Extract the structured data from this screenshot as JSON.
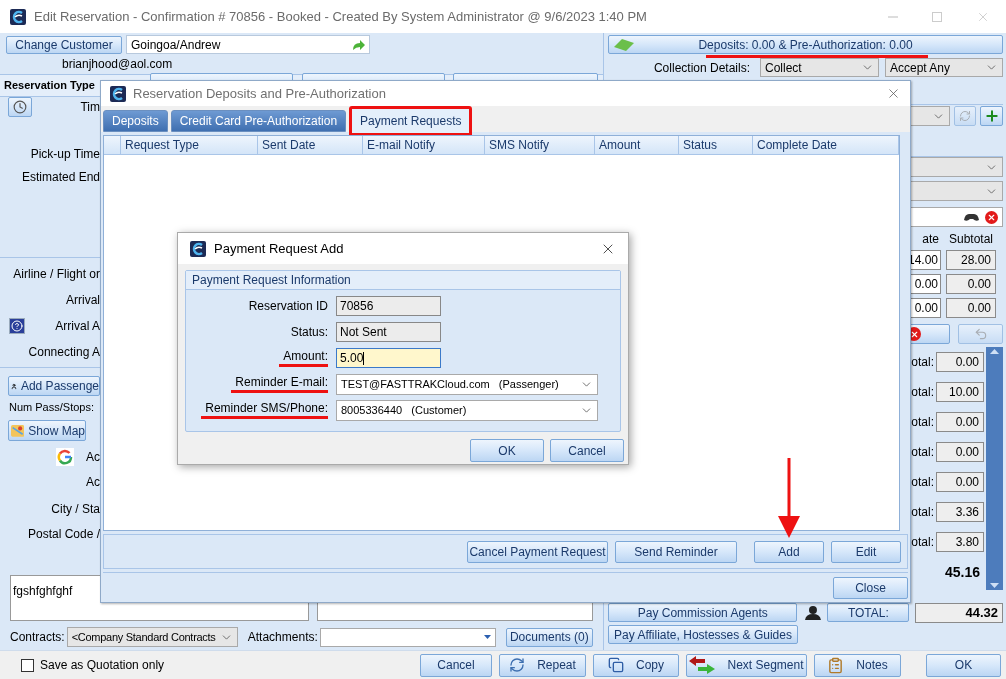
{
  "window": {
    "title": "Edit Reservation - Confirmation # 70856 - Booked - Created By System Administrator @ 9/6/2023 1:40 PM"
  },
  "customer": {
    "button": "Change Customer",
    "name": "Goingoa/Andrew",
    "email": "brianjhood@aol.com"
  },
  "reservation_type": {
    "label": "Reservation Type"
  },
  "trip_labels": [
    "Tim",
    "Pick-up Time",
    "Estimated End"
  ],
  "flight_labels": [
    "Airline / Flight or",
    "Arrival",
    "Arrival A",
    "Connecting A"
  ],
  "passengers": {
    "add_button": "Add Passenge",
    "count_label": "Num Pass/Stops:",
    "map_button": "Show Map"
  },
  "address_labels": [
    "Ac",
    "Ac",
    "City / Sta",
    "Postal Code /"
  ],
  "notes_text": "fgshfghfghf",
  "contracts": {
    "label": "Contracts:",
    "value": "<Company Standard Contracts"
  },
  "attachments": {
    "label": "Attachments:",
    "button": "Documents (0)"
  },
  "quotation": {
    "label": "Save as Quotation only",
    "checked": false
  },
  "footer_buttons": [
    {
      "label": "Cancel",
      "kind": "plain"
    },
    {
      "label": "Repeat",
      "kind": "repeat"
    },
    {
      "label": "Copy",
      "kind": "copy"
    },
    {
      "label": "Next Segment",
      "kind": "next"
    },
    {
      "label": "Notes",
      "kind": "notes"
    },
    {
      "label": "OK",
      "kind": "plain"
    }
  ],
  "deposits_button": {
    "label": "Deposits: 0.00 & Pre-Authorization: 0.00",
    "underlined": true
  },
  "collection": {
    "label": "Collection Details:",
    "method": "Collect",
    "accept": "Accept Any"
  },
  "rates": {
    "headers": [
      "ate",
      "Subtotal"
    ],
    "rows": [
      [
        "14.00",
        "28.00"
      ],
      [
        "0.00",
        "0.00"
      ],
      [
        "0.00",
        "0.00"
      ]
    ]
  },
  "totals": {
    "rows": [
      {
        "label": "otal:",
        "value": "0.00"
      },
      {
        "label": "otal:",
        "value": "10.00"
      },
      {
        "label": "otal:",
        "value": "0.00"
      },
      {
        "label": "otal:",
        "value": "0.00"
      },
      {
        "label": "otal:",
        "value": "0.00"
      },
      {
        "label": "otal:",
        "value": "3.36"
      },
      {
        "label": "otal:",
        "value": "3.80"
      }
    ],
    "sum": "45.16"
  },
  "commission": {
    "button": "Pay Commission Agents",
    "total_label": "TOTAL:",
    "total_value": "44.32",
    "affiliate_button": "Pay Affiliate, Hostesses & Guides"
  },
  "deposits_dialog": {
    "title": "Reservation Deposits and Pre-Authorization",
    "tabs": [
      {
        "label": "Deposits",
        "selected": false,
        "highlighted": false
      },
      {
        "label": "Credit Card Pre-Authorization",
        "selected": false,
        "highlighted": false
      },
      {
        "label": "Payment Requests",
        "selected": true,
        "highlighted": true
      }
    ],
    "columns": [
      "Request Type",
      "Sent Date",
      "E-mail Notify",
      "SMS Notify",
      "Amount",
      "Status",
      "Complete Date"
    ],
    "buttons": [
      {
        "label": "Cancel Payment Request",
        "arrow": false
      },
      {
        "label": "Send Reminder",
        "arrow": false
      },
      {
        "label": "Add",
        "arrow": true
      },
      {
        "label": "Edit",
        "arrow": false
      }
    ],
    "close_button": "Close"
  },
  "payment_dialog": {
    "title": "Payment Request Add",
    "group": "Payment Request Information",
    "fields": [
      {
        "label": "Reservation ID",
        "value": "70856",
        "kind": "readonly",
        "underlined": false
      },
      {
        "label": "Status:",
        "value": "Not Sent",
        "kind": "readonly",
        "underlined": false
      },
      {
        "label": "Amount:",
        "value": "5.00",
        "kind": "input",
        "underlined": true
      },
      {
        "label": "Reminder E-mail:",
        "value": "TEST@FASTTRAKCloud.com   (Passenger)",
        "kind": "dropdown",
        "underlined": true
      },
      {
        "label": "Reminder SMS/Phone:",
        "value": "8005336440   (Customer)",
        "kind": "dropdown",
        "underlined": true
      }
    ],
    "buttons": [
      "OK",
      "Cancel"
    ]
  }
}
